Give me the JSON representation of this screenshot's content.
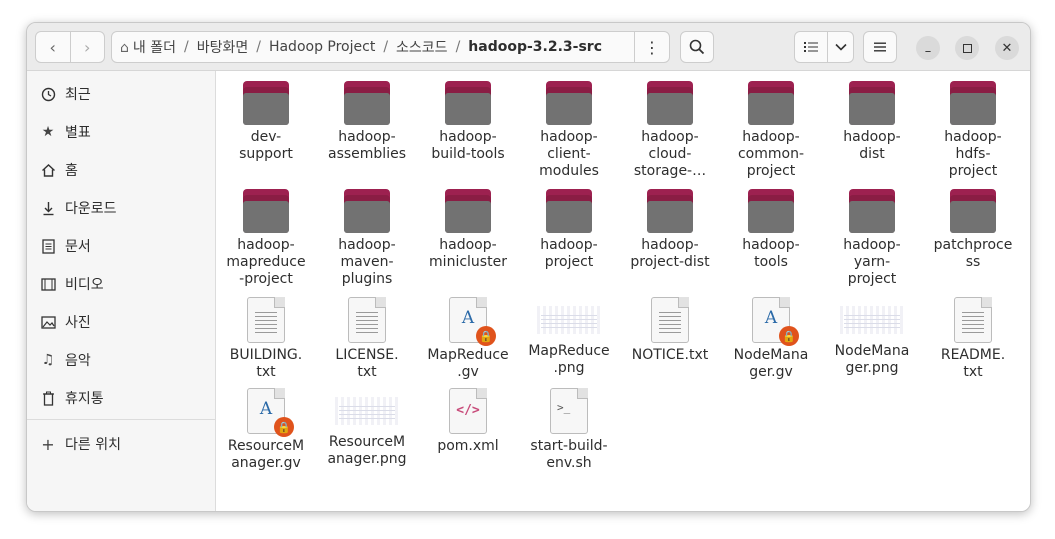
{
  "headerbar": {
    "back_icon": "chevron-left-icon",
    "forward_icon": "chevron-right-icon",
    "breadcrumb": [
      {
        "label": "내 폴더",
        "icon": "home-icon"
      },
      {
        "label": "바탕화면"
      },
      {
        "label": "Hadoop Project"
      },
      {
        "label": "소스코드"
      },
      {
        "label": "hadoop-3.2.3-src"
      }
    ],
    "separator": "/"
  },
  "sidebar": {
    "items": [
      {
        "label": "최근",
        "icon": "clock-icon"
      },
      {
        "label": "별표",
        "icon": "star-icon"
      },
      {
        "label": "홈",
        "icon": "home-icon"
      },
      {
        "label": "다운로드",
        "icon": "download-icon"
      },
      {
        "label": "문서",
        "icon": "document-icon"
      },
      {
        "label": "비디오",
        "icon": "video-icon"
      },
      {
        "label": "사진",
        "icon": "picture-icon"
      },
      {
        "label": "음악",
        "icon": "music-icon"
      },
      {
        "label": "휴지통",
        "icon": "trash-icon"
      }
    ],
    "other_locations": {
      "label": "다른 위치",
      "icon": "plus-icon"
    }
  },
  "files": [
    {
      "label": "dev-\nsupport",
      "type": "folder"
    },
    {
      "label": "hadoop-\nassemblies",
      "type": "folder"
    },
    {
      "label": "hadoop-\nbuild-tools",
      "type": "folder"
    },
    {
      "label": "hadoop-\nclient-\nmodules",
      "type": "folder"
    },
    {
      "label": "hadoop-\ncloud-\nstorage-…",
      "type": "folder"
    },
    {
      "label": "hadoop-\ncommon-\nproject",
      "type": "folder"
    },
    {
      "label": "hadoop-\ndist",
      "type": "folder"
    },
    {
      "label": "hadoop-\nhdfs-\nproject",
      "type": "folder"
    },
    {
      "label": "hadoop-\nmapreduce\n-project",
      "type": "folder"
    },
    {
      "label": "hadoop-\nmaven-\nplugins",
      "type": "folder"
    },
    {
      "label": "hadoop-\nminicluster",
      "type": "folder"
    },
    {
      "label": "hadoop-\nproject",
      "type": "folder"
    },
    {
      "label": "hadoop-\nproject-dist",
      "type": "folder"
    },
    {
      "label": "hadoop-\ntools",
      "type": "folder"
    },
    {
      "label": "hadoop-\nyarn-\nproject",
      "type": "folder"
    },
    {
      "label": "patchproce\nss",
      "type": "folder"
    },
    {
      "label": "BUILDING.\ntxt",
      "type": "text"
    },
    {
      "label": "LICENSE.\ntxt",
      "type": "text"
    },
    {
      "label": "MapReduce\n.gv",
      "type": "gv"
    },
    {
      "label": "MapReduce\n.png",
      "type": "png"
    },
    {
      "label": "NOTICE.txt",
      "type": "text"
    },
    {
      "label": "NodeMana\nger.gv",
      "type": "gv"
    },
    {
      "label": "NodeMana\nger.png",
      "type": "png"
    },
    {
      "label": "README.\ntxt",
      "type": "text"
    },
    {
      "label": "ResourceM\nanager.gv",
      "type": "gv"
    },
    {
      "label": "ResourceM\nanager.png",
      "type": "png"
    },
    {
      "label": "pom.xml",
      "type": "xml"
    },
    {
      "label": "start-build-\nenv.sh",
      "type": "sh"
    }
  ],
  "glyphs": {
    "gv": "A",
    "xml": "</>",
    "sh": ">_",
    "lock": "🔒"
  }
}
